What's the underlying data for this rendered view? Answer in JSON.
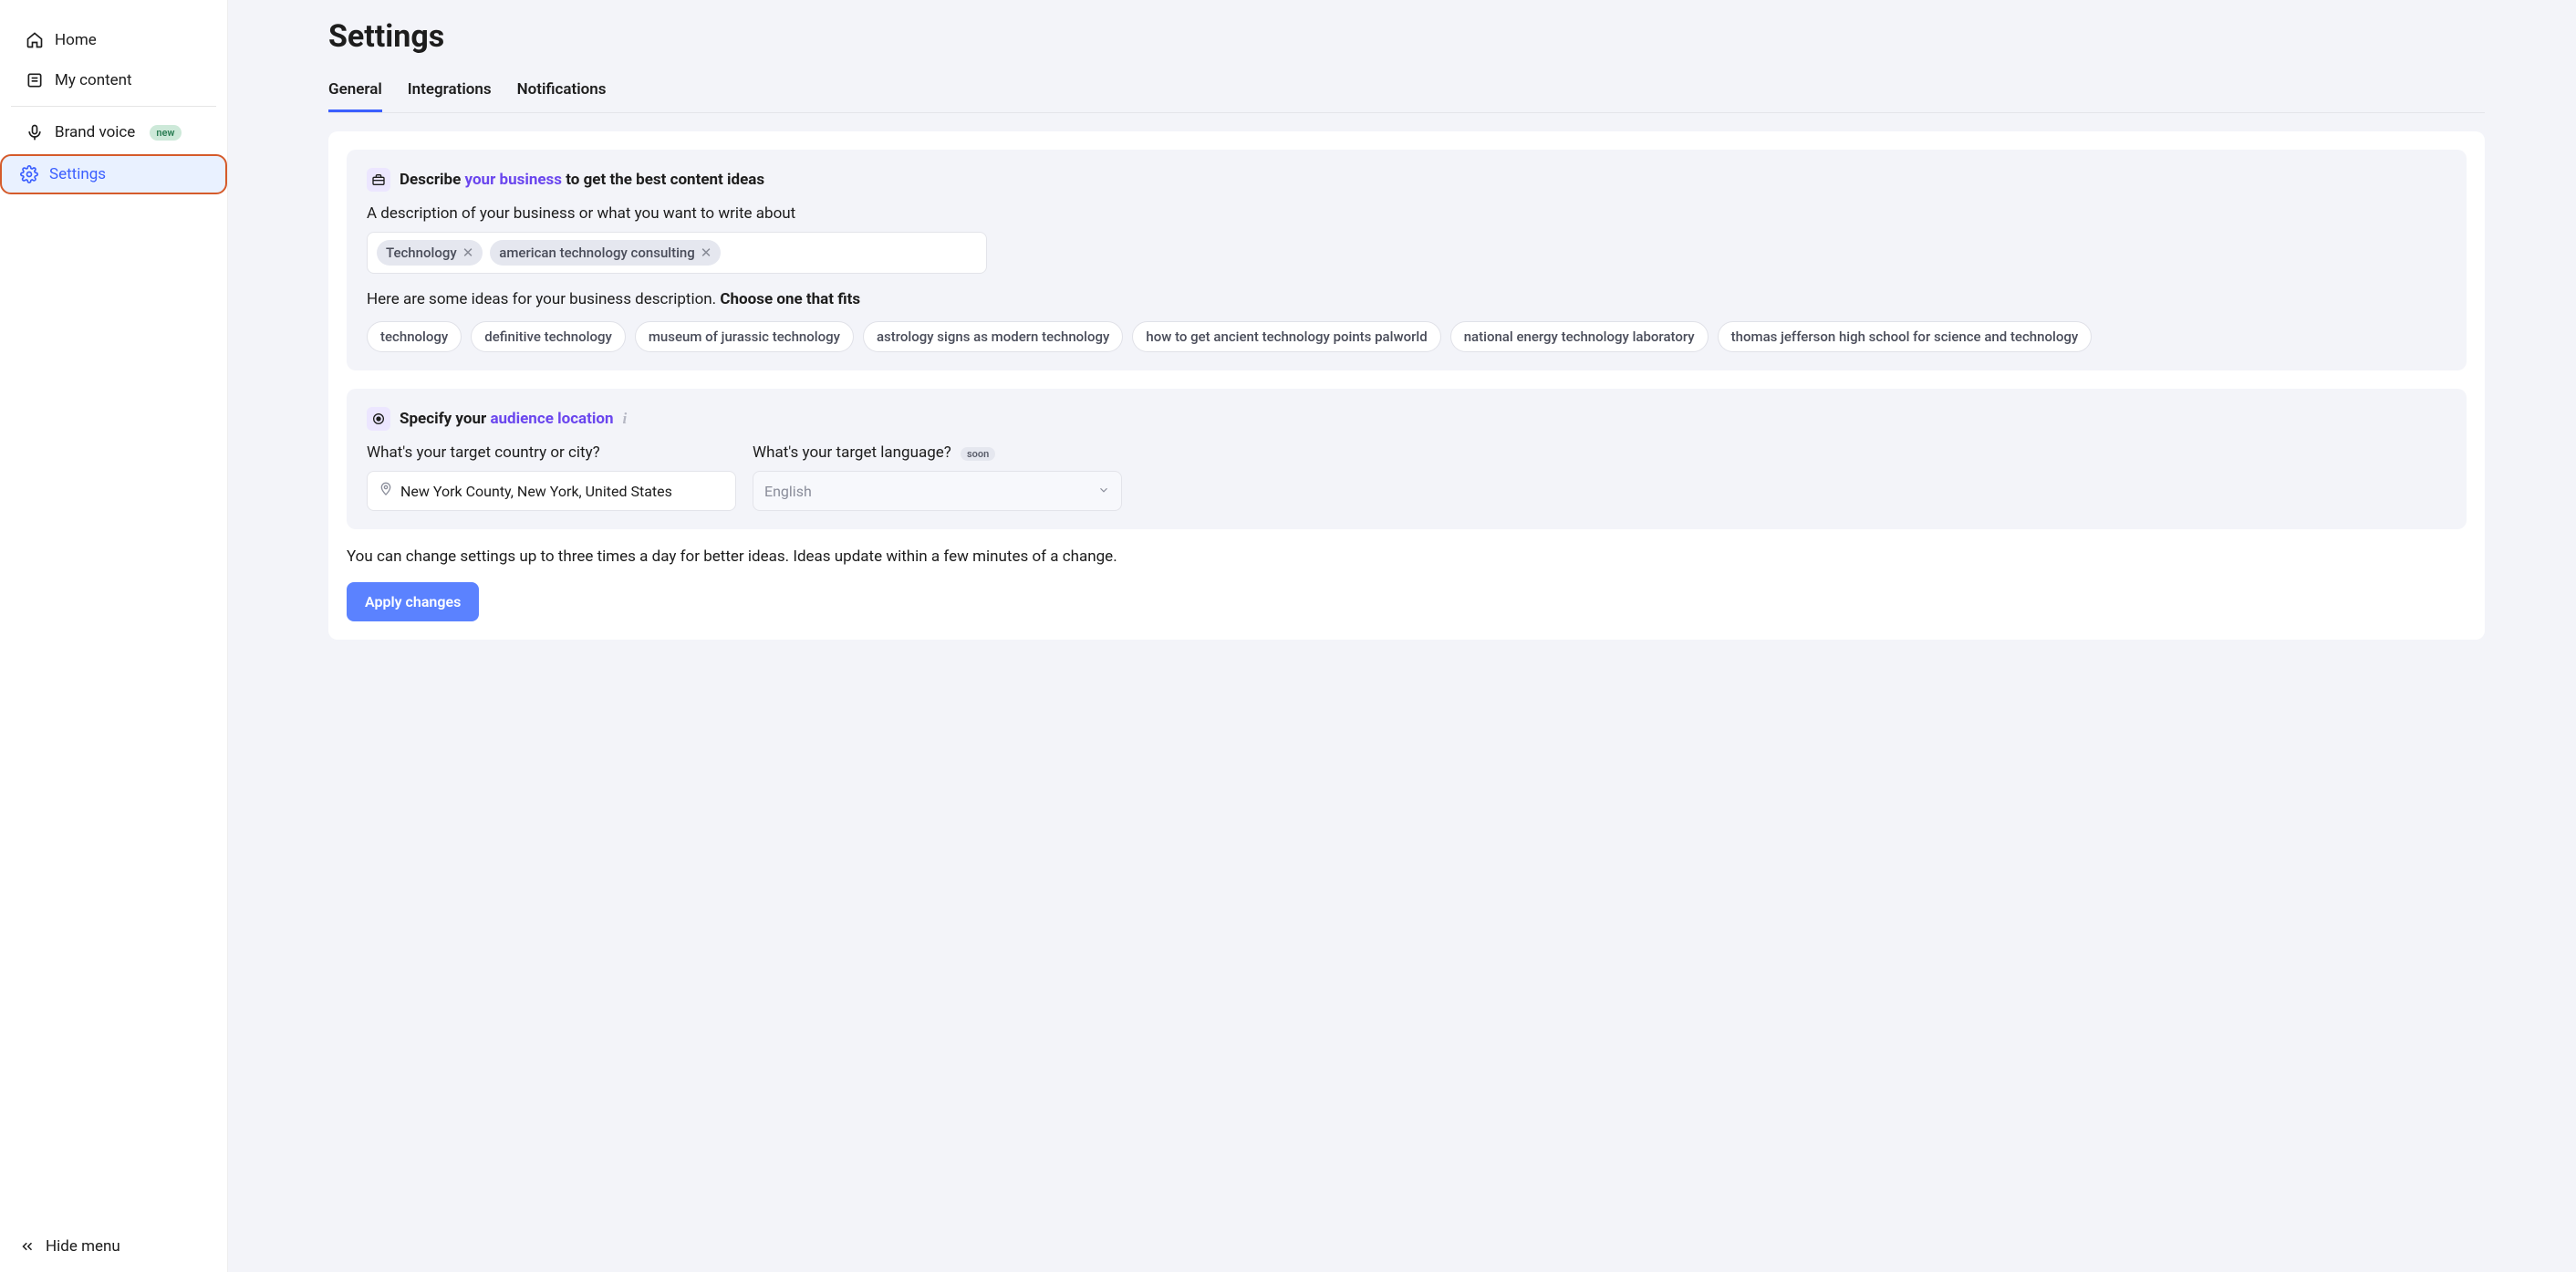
{
  "sidebar": {
    "items": [
      {
        "label": "Home"
      },
      {
        "label": "My content"
      },
      {
        "label": "Brand voice",
        "badge": "new"
      },
      {
        "label": "Settings"
      }
    ],
    "hide_menu": "Hide menu"
  },
  "page": {
    "title": "Settings"
  },
  "tabs": [
    {
      "label": "General",
      "active": true
    },
    {
      "label": "Integrations"
    },
    {
      "label": "Notifications"
    }
  ],
  "business": {
    "heading_prefix": "Describe ",
    "heading_accent": "your business",
    "heading_suffix": " to get the best content ideas",
    "description_label": "A description of your business or what you want to write about",
    "tags": [
      "Technology",
      "american technology consulting"
    ],
    "ideas_prefix": "Here are some ideas for your business description. ",
    "ideas_bold": "Choose one that fits",
    "ideas": [
      "technology",
      "definitive technology",
      "museum of jurassic technology",
      "astrology signs as modern technology",
      "how to get ancient technology points palworld",
      "national energy technology laboratory",
      "thomas jefferson high school for science and technology"
    ]
  },
  "audience": {
    "heading_prefix": "Specify your ",
    "heading_accent": "audience location",
    "country_label": "What's your target country or city?",
    "country_value": "New York County, New York, United States",
    "language_label": "What's your target language?",
    "language_badge": "soon",
    "language_value": "English"
  },
  "footer": {
    "note": "You can change settings up to three times a day for better ideas. Ideas update within a few minutes of a change.",
    "apply": "Apply changes"
  }
}
